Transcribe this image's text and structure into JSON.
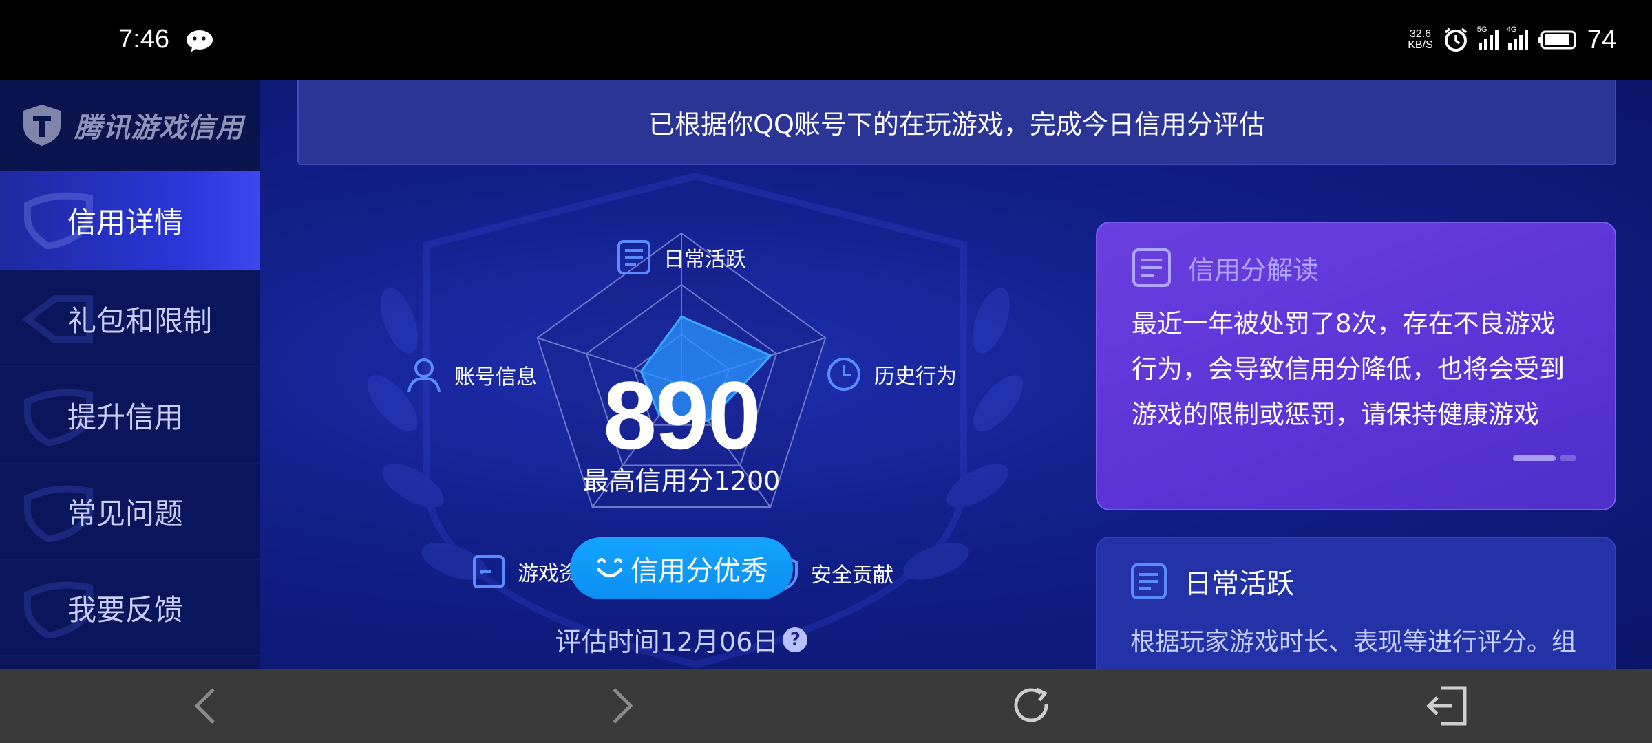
{
  "status_bar": {
    "time": "7:46",
    "net_speed_value": "32.6",
    "net_speed_unit": "KB/S",
    "sig1_label": "5G",
    "sig2_label": "4G",
    "battery": "74",
    "notification_icon": "wechat-icon"
  },
  "sidebar": {
    "brand": "腾讯游戏信用",
    "items": [
      {
        "label": "信用详情",
        "active": true
      },
      {
        "label": "礼包和限制",
        "active": false
      },
      {
        "label": "提升信用",
        "active": false
      },
      {
        "label": "常见问题",
        "active": false
      },
      {
        "label": "我要反馈",
        "active": false
      }
    ]
  },
  "notice": "已根据你QQ账号下的在玩游戏，完成今日信用分评估",
  "radar": {
    "axes": [
      {
        "label": "日常活跃",
        "icon": "doc-icon"
      },
      {
        "label": "历史行为",
        "icon": "clock-icon"
      },
      {
        "label": "安全贡献",
        "icon": "shield-icon"
      },
      {
        "label": "游戏资产",
        "icon": "wallet-icon"
      },
      {
        "label": "账号信息",
        "icon": "user-icon"
      }
    ],
    "values": [
      0.45,
      0.62,
      0.3,
      0.25,
      0.28
    ]
  },
  "score": "890",
  "score_max": "最高信用分1200",
  "level_button": "信用分优秀",
  "eval_time": "评估时间12月06日",
  "interpretation": {
    "title": "信用分解读",
    "body": "最近一年被处罚了8次，存在不良游戏行为，会导致信用分降低，也将会受到游戏的限制或惩罚，请保持健康游戏"
  },
  "daily_card": {
    "title": "日常活跃",
    "desc": "根据玩家游戏时长、表现等进行评分。组"
  },
  "colors": {
    "accent": "#0b8ef0",
    "card_purple": "#5a34d6",
    "bg_blue": "#12208c"
  }
}
